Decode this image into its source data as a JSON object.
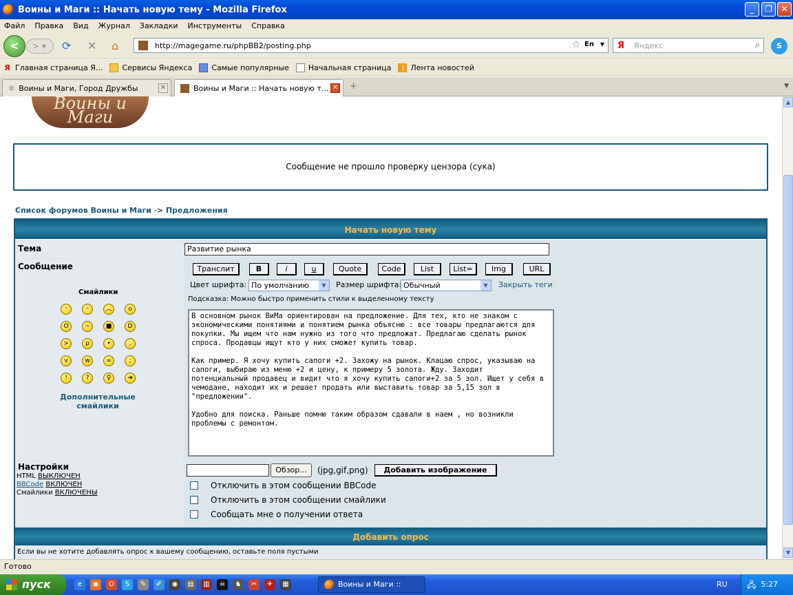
{
  "window": {
    "title": "Воины и Маги :: Начать новую тему - Mozilla Firefox"
  },
  "menu": [
    "Файл",
    "Правка",
    "Вид",
    "Журнал",
    "Закладки",
    "Инструменты",
    "Справка"
  ],
  "nav": {
    "url": "http://magegame.ru/phpBB2/posting.php",
    "lang": "En",
    "search_placeholder": "Яндекс",
    "search_brand": "Я"
  },
  "bookmarks": [
    "Главная страница Я...",
    "Сервисы Яндекса",
    "Самые популярные",
    "Начальная страница",
    "Лента новостей"
  ],
  "tabs": [
    {
      "label": "Воины и Маги, Город Дружбы"
    },
    {
      "label": "Воины и Маги :: Начать новую т..."
    }
  ],
  "page": {
    "logo_text": "Воины и Маги",
    "censor_message": "Сообщение не прошло проверку цензора (сука)",
    "breadcrumb": {
      "forum_list": "Список форумов Воины и Маги",
      "sep": "->",
      "section": "Предложения"
    },
    "form_title": "Начать новую тему",
    "subject_label": "Тема",
    "subject_value": "Развитие рынка",
    "message_label": "Сообщение",
    "smilies_title": "Смайлики",
    "more_smilies": "Дополнительные смайлики",
    "bbcode_buttons": [
      "Транслит",
      "B",
      "i",
      "u",
      "Quote",
      "Code",
      "List",
      "List=",
      "Img",
      "URL"
    ],
    "font_color_label": "Цвет шрифта:",
    "font_color_value": "По умолчанию",
    "font_size_label": "Размер шрифта:",
    "font_size_value": "Обычный",
    "close_tags": "Закрыть теги",
    "hint": "Подсказка: Можно быстро применить стили к выделенному тексту",
    "message_text": "В основном рынок ВиМа ориентирован на предложение. Для тех, кто не знаком с\nэкономическими понятиями и понятием рынка объясню : все товары предлагаются для\nпокупки. Мы ищем что нам нужно из того что предложат. Предлагаю сделать рынок\nспроса. Продавцы ищут кто у них сможет купить товар.\n\nКак пример. Я хочу купить сапоги +2. Захожу на рынок. Клацаю спрос, указываю на\nсапоги, выбираю из меню +2 и цену, к примеру 5 золота. Жду. Заходит\nпотенциальный продавец и видит что я хочу купить сапоги+2 за 5 зол. Ищет у себя в\nчемодане, находит их и решает продать или выставить товар за 5,15 зол в\n\"предложении\".\n\nУдобно для поиска. Раньше помню таким образом сдавали в наем , но возникли\nпроблемы с ремонтом.",
    "settings_label": "Настройки",
    "settings": {
      "html": "HTML",
      "html_state": "ВЫКЛЮЧЕН",
      "bbcode": "BBCode",
      "bbcode_state": "ВКЛЮЧЕН",
      "smilies": "Смайлики",
      "smilies_state": "ВКЛЮЧЕНЫ"
    },
    "browse_button": "Обзор...",
    "file_types": "(jpg,gif,png)",
    "add_image_button": "Добавить изображение",
    "options": [
      "Отключить в этом сообщении BBCode",
      "Отключить в этом сообщении смайлики",
      "Сообщать мне о получении ответа"
    ],
    "poll_title": "Добавить опрос",
    "poll_hint": "Если вы не хотите добавлять опрос к вашему сообщению, оставьте поля пустыми"
  },
  "status": "Готово",
  "taskbar": {
    "start": "пуск",
    "task": "Воины и Маги :: Нач...",
    "lang": "RU",
    "time": "5:27"
  }
}
